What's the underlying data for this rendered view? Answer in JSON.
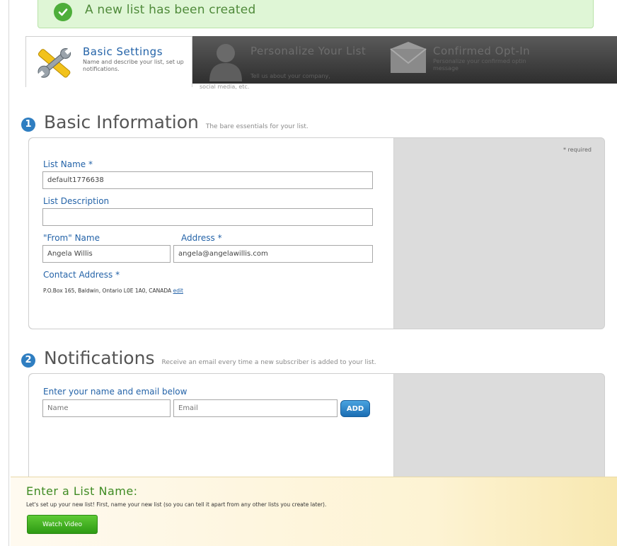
{
  "colors": {
    "accent": "#2463a8",
    "success": "#4dae3a",
    "tip_green": "#3f8b23"
  },
  "banner": {
    "message": "A new list has been created",
    "icon": "check-icon"
  },
  "steps": [
    {
      "title": "Basic Settings",
      "desc": "Name and describe your list, set up notifications.",
      "icon": "wrench-icon",
      "active": true
    },
    {
      "title": "Personalize Your List",
      "desc": "Tell us about your company,",
      "desc_overflow": "social media, etc.",
      "icon": "person-silhouette-icon",
      "active": false
    },
    {
      "title": "Confirmed Opt-In",
      "desc": "Personalize your confirmed optin message",
      "icon": "envelope-icon",
      "active": false
    }
  ],
  "basic": {
    "number": "1",
    "title": "Basic Information",
    "subtitle": "The bare essentials for your list.",
    "required_note": "* required",
    "list_name_label": "List Name *",
    "list_name_value": "default1776638",
    "list_desc_label": "List Description",
    "list_desc_value": "",
    "from_name_label": "\"From\" Name",
    "from_name_value": "Angela Willis",
    "address_label": "Address *",
    "address_value": "angela@angelawillis.com",
    "contact_label": "Contact Address *",
    "contact_value": "P.O.Box 165, Baldwin, Ontario L0E 1A0, CANADA",
    "edit_link": "edit"
  },
  "notifications": {
    "number": "2",
    "title": "Notifications",
    "subtitle": "Receive an email every time a new subscriber is added to your list.",
    "prompt": "Enter your name and email below",
    "name_placeholder": "Name",
    "email_placeholder": "Email",
    "add_label": "ADD"
  },
  "tip": {
    "title": "Enter a List Name:",
    "body": "Let's set up your new list! First, name your new list (so you can tell it apart from any other lists you create later).",
    "button": "Watch Video"
  }
}
